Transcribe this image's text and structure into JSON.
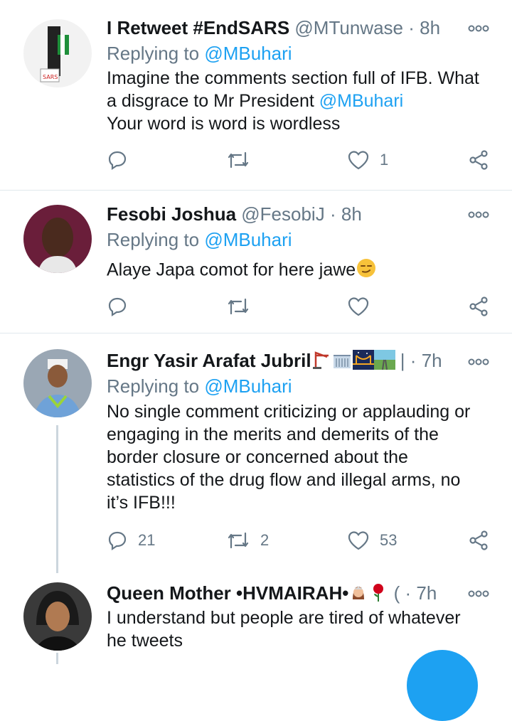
{
  "tweets": [
    {
      "name": "I Retweet #EndSARS",
      "handle": "@MTunwase",
      "time": "8h",
      "replying_prefix": "Replying to",
      "replying_to": "@MBuhari",
      "body_line1": "Imagine the comments section full of IFB. What",
      "body_line2_pre": "a disgrace to Mr President",
      "body_mention": "@MBuhari",
      "body_line3": "Your word is word is wordless",
      "reply_count": "",
      "retweet_count": "",
      "like_count": "1"
    },
    {
      "name": "Fesobi Joshua",
      "handle": "@FesobiJ",
      "time": "8h",
      "replying_prefix": "Replying to",
      "replying_to": "@MBuhari",
      "body": "Alaye Japa comot for here jawe",
      "reply_count": "",
      "retweet_count": "",
      "like_count": ""
    },
    {
      "name": "Engr Yasir Arafat Jubril",
      "time": "7h",
      "replying_prefix": "Replying to",
      "replying_to": "@MBuhari",
      "body_lines": [
        "No single comment criticizing or applauding or",
        "engaging in the merits and demerits of the",
        "border closure or concerned about the",
        "statistics of the drug flow and illegal arms, no",
        "it’s IFB!!!"
      ],
      "reply_count": "21",
      "retweet_count": "2",
      "like_count": "53"
    },
    {
      "name": "Queen Mother •HVMAIRAH•",
      "handle_partial": "(",
      "time": "7h",
      "body_lines": [
        "I understand but people are tired of whatever",
        "he tweets"
      ]
    }
  ],
  "icons": {
    "more": "more-options-icon",
    "reply": "reply-icon",
    "retweet": "retweet-icon",
    "like": "like-icon",
    "share": "share-icon"
  },
  "colors": {
    "accent": "#1da1f2",
    "muted": "#657786",
    "divider": "#e1e8ed"
  }
}
